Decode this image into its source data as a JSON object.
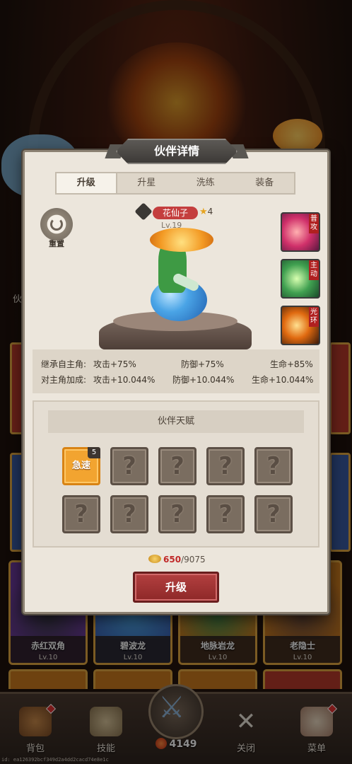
{
  "colors": {
    "panel_bg": "#ece6dc",
    "accent_red": "#b44040",
    "talent_active": "#f2a430",
    "coin_have": "#c02828"
  },
  "panel": {
    "title": "伙伴详情",
    "tabs": [
      {
        "label": "升级",
        "active": true
      },
      {
        "label": "升星",
        "active": false
      },
      {
        "label": "洗练",
        "active": false
      },
      {
        "label": "装备",
        "active": false
      }
    ],
    "reset_label": "重置",
    "companion": {
      "name": "花仙子",
      "stars": "4",
      "level": "Lv.19",
      "star_icon": "star-icon"
    },
    "skills": [
      {
        "tag": "普攻",
        "icon": "normal-attack-skill-icon"
      },
      {
        "tag": "主动",
        "icon": "active-skill-icon"
      },
      {
        "tag": "光环",
        "icon": "aura-skill-icon"
      }
    ],
    "stats": {
      "inherit_label": "继承自主角:",
      "inherit": {
        "attack": "攻击+75%",
        "defense": "防御+75%",
        "hp": "生命+85%"
      },
      "bonus_label": "对主角加成:",
      "bonus": {
        "attack": "攻击+10.044%",
        "defense": "防御+10.044%",
        "hp": "生命+10.044%"
      }
    },
    "talent": {
      "title": "伙伴天赋",
      "unlocked": {
        "name": "急速",
        "count": "5"
      },
      "locked_symbol": "?"
    },
    "cost": {
      "have": "650",
      "need": "/9075",
      "icon": "gold-coin-icon"
    },
    "upgrade_label": "升级"
  },
  "background": {
    "side_label": "伙",
    "heroes": [
      {
        "name": "赤红双角",
        "level": "Lv.10"
      },
      {
        "name": "碧波龙",
        "level": "Lv.10"
      },
      {
        "name": "地脉岩龙",
        "level": "Lv.10"
      },
      {
        "name": "老隐士",
        "level": "Lv.10"
      }
    ]
  },
  "nav": {
    "items": [
      {
        "label": "背包",
        "icon": "backpack-icon",
        "badge": true
      },
      {
        "label": "技能",
        "icon": "skill-scroll-icon",
        "badge": false
      },
      {
        "label": "关闭",
        "icon": "crossed-swords-close-icon",
        "badge": false
      },
      {
        "label": "菜单",
        "icon": "menu-book-icon",
        "badge": true
      }
    ],
    "power": "4149"
  },
  "footer_id": "id: ea126392bcf349d2a4dd2cacd74e8e1c"
}
